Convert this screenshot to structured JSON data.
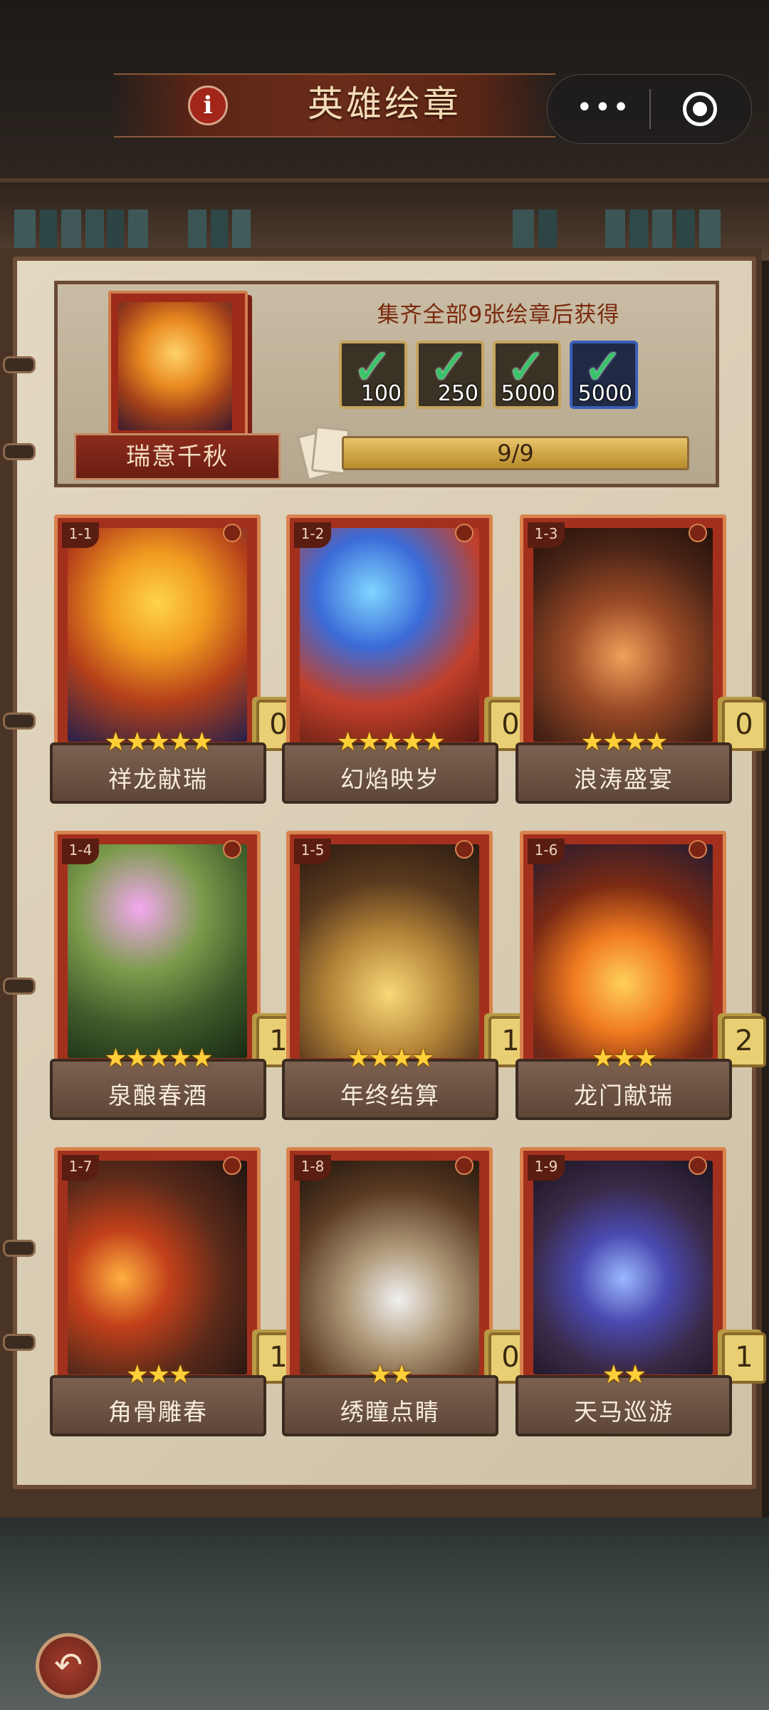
{
  "header": {
    "title": "英雄绘章",
    "info_icon": "info-icon",
    "more_icon": "more-dots-icon",
    "close_icon": "close-target-icon"
  },
  "set": {
    "name": "瑞意千秋",
    "caption": "集齐全部9张绘章后获得",
    "progress_text": "9/9",
    "progress_value": 1.0,
    "rewards": [
      {
        "amount": "100",
        "claimed": true,
        "icon": "weapon-crate-icon"
      },
      {
        "amount": "250",
        "claimed": true,
        "icon": "book-stack-icon"
      },
      {
        "amount": "5000",
        "claimed": true,
        "icon": "gold-bar-icon"
      },
      {
        "amount": "5000",
        "claimed": true,
        "icon": "blue-scroll-icon"
      }
    ]
  },
  "cards": [
    {
      "id": "1-1",
      "name": "祥龙献瑞",
      "stars": 5,
      "count": "0"
    },
    {
      "id": "1-2",
      "name": "幻焰映岁",
      "stars": 5,
      "count": "0"
    },
    {
      "id": "1-3",
      "name": "浪涛盛宴",
      "stars": 4,
      "count": "0"
    },
    {
      "id": "1-4",
      "name": "泉酿春酒",
      "stars": 5,
      "count": "1"
    },
    {
      "id": "1-5",
      "name": "年终结算",
      "stars": 4,
      "count": "1"
    },
    {
      "id": "1-6",
      "name": "龙门献瑞",
      "stars": 3,
      "count": "2"
    },
    {
      "id": "1-7",
      "name": "角骨雕春",
      "stars": 3,
      "count": "1"
    },
    {
      "id": "1-8",
      "name": "绣瞳点睛",
      "stars": 2,
      "count": "0"
    },
    {
      "id": "1-9",
      "name": "天马巡游",
      "stars": 2,
      "count": "1"
    }
  ],
  "footer": {
    "back_icon": "back-arrow-icon"
  },
  "colors": {
    "accent_red": "#a3301d",
    "gold": "#e9cf73",
    "check_green": "#39c46a",
    "parchment": "#d9cdb4"
  }
}
